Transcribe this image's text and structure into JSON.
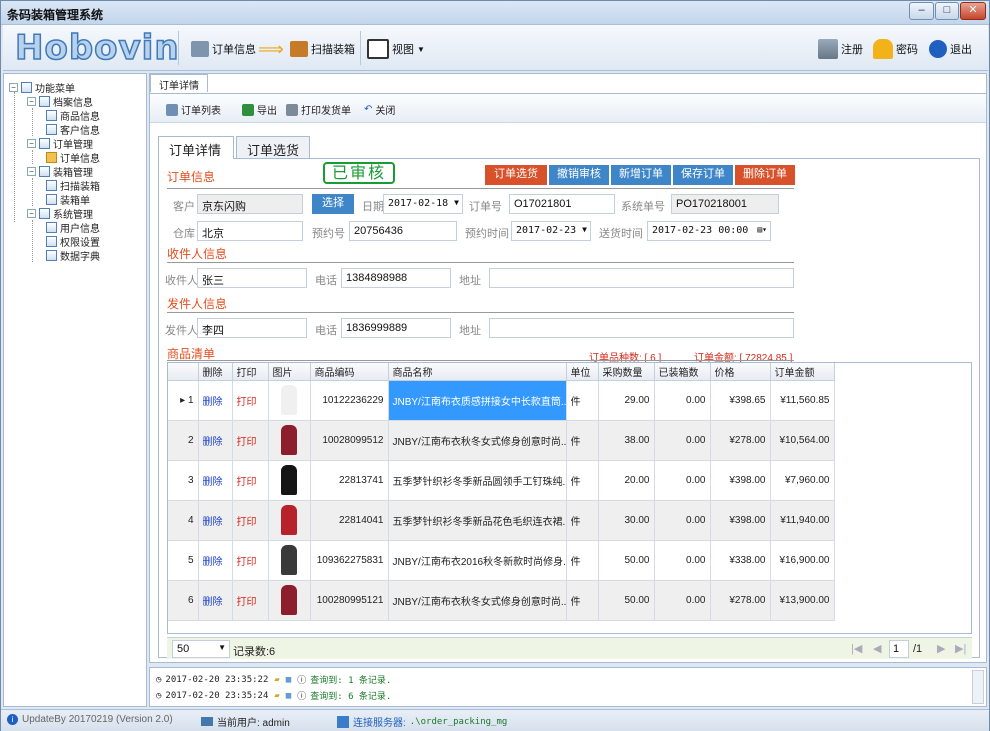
{
  "window": {
    "title": "条码装箱管理系统",
    "min": "–",
    "max": "□",
    "close": "✕"
  },
  "toolbar": {
    "logo": "Hobovin",
    "order_info": "订单信息",
    "scan_pack": "扫描装箱",
    "view": "视图",
    "register": "注册",
    "password": "密码",
    "exit": "退出"
  },
  "tree": {
    "root": "功能菜单",
    "archive": "档案信息",
    "goods": "商品信息",
    "customer": "客户信息",
    "order_mgmt": "订单管理",
    "order_info": "订单信息",
    "pack_mgmt": "装箱管理",
    "scan_pack": "扫描装箱",
    "pack_list": "装箱单",
    "sys_mgmt": "系统管理",
    "user_info": "用户信息",
    "perm": "权限设置",
    "dict": "数据字典"
  },
  "doc_tab": "订单详情",
  "subbar": {
    "list": "订单列表",
    "export": "导出",
    "print_ship": "打印发货单",
    "close": "关闭"
  },
  "tabs": {
    "detail": "订单详情",
    "select": "订单选货"
  },
  "order": {
    "section": "订单信息",
    "status": "已审核",
    "buttons": {
      "select": "订单选货",
      "revoke": "撤销审核",
      "add": "新增订单",
      "save": "保存订单",
      "delete": "删除订单"
    },
    "customer_label": "客户",
    "customer": "京东闪购",
    "choose": "选择",
    "date_label": "日期",
    "date": "2017-02-18",
    "order_no_label": "订单号",
    "order_no": "O17021801",
    "sys_no_label": "系统单号",
    "sys_no": "PO170218001",
    "warehouse_label": "仓库",
    "warehouse": "北京",
    "prebook_label": "预约号",
    "prebook": "20756436",
    "pretime_label": "预约时间",
    "pretime": "2017-02-23",
    "ship_label": "送货时间",
    "ship": "2017-02-23 00:00"
  },
  "receiver": {
    "section": "收件人信息",
    "name_label": "收件人",
    "name": "张三",
    "phone_label": "电话",
    "phone": "1384898988",
    "addr_label": "地址",
    "addr": ""
  },
  "sender": {
    "section": "发件人信息",
    "name_label": "发件人",
    "name": "李四",
    "phone_label": "电话",
    "phone": "1836999889",
    "addr_label": "地址",
    "addr": ""
  },
  "goods": {
    "section": "商品清单",
    "kinds": "订单品种数: [ 6 ]",
    "amount": "订单金额: [ 72824.85 ]",
    "headers": [
      "删除",
      "打印",
      "图片",
      "商品编码",
      "商品名称",
      "单位",
      "采购数量",
      "已装箱数",
      "价格",
      "订单金额"
    ],
    "rows": [
      {
        "n": "1",
        "del": "删除",
        "prt": "打印",
        "code": "10122236229",
        "name": "JNBY/江南布衣质感拼接女中长款直筒...",
        "unit": "件",
        "qty": "29.00",
        "packed": "0.00",
        "price": "¥398.65",
        "amt": "¥11,560.85",
        "color": "#f0f0f0"
      },
      {
        "n": "2",
        "del": "删除",
        "prt": "打印",
        "code": "10028099512",
        "name": "JNBY/江南布衣秋冬女式修身创意时尚...",
        "unit": "件",
        "qty": "38.00",
        "packed": "0.00",
        "price": "¥278.00",
        "amt": "¥10,564.00",
        "color": "#8c1f2b"
      },
      {
        "n": "3",
        "del": "删除",
        "prt": "打印",
        "code": "22813741",
        "name": "五季梦针织衫冬季新品圆领手工钉珠纯...",
        "unit": "件",
        "qty": "20.00",
        "packed": "0.00",
        "price": "¥398.00",
        "amt": "¥7,960.00",
        "color": "#151515"
      },
      {
        "n": "4",
        "del": "删除",
        "prt": "打印",
        "code": "22814041",
        "name": "五季梦针织衫冬季新品花色毛织连衣裙...",
        "unit": "件",
        "qty": "30.00",
        "packed": "0.00",
        "price": "¥398.00",
        "amt": "¥11,940.00",
        "color": "#b8222c"
      },
      {
        "n": "5",
        "del": "删除",
        "prt": "打印",
        "code": "109362275831",
        "name": "JNBY/江南布衣2016秋冬新款时尚修身...",
        "unit": "件",
        "qty": "50.00",
        "packed": "0.00",
        "price": "¥338.00",
        "amt": "¥16,900.00",
        "color": "#3a3a3a"
      },
      {
        "n": "6",
        "del": "删除",
        "prt": "打印",
        "code": "100280995121",
        "name": "JNBY/江南布衣秋冬女式修身创意时尚...",
        "unit": "件",
        "qty": "50.00",
        "packed": "0.00",
        "price": "¥278.00",
        "amt": "¥13,900.00",
        "color": "#8c1f2b"
      }
    ]
  },
  "pager": {
    "size": "50",
    "records": "记录数:6",
    "page": "1",
    "total": "/1"
  },
  "log": [
    {
      "time": "2017-02-20 23:35:22",
      "msg": "查询到: 1 条记录."
    },
    {
      "time": "2017-02-20 23:35:24",
      "msg": "查询到: 6 条记录."
    }
  ],
  "status": {
    "update": "UpdateBy 20170219 (Version 2.0)",
    "user": "当前用户: admin",
    "server_label": "连接服务器:",
    "server": ".\\order_packing_mg"
  }
}
